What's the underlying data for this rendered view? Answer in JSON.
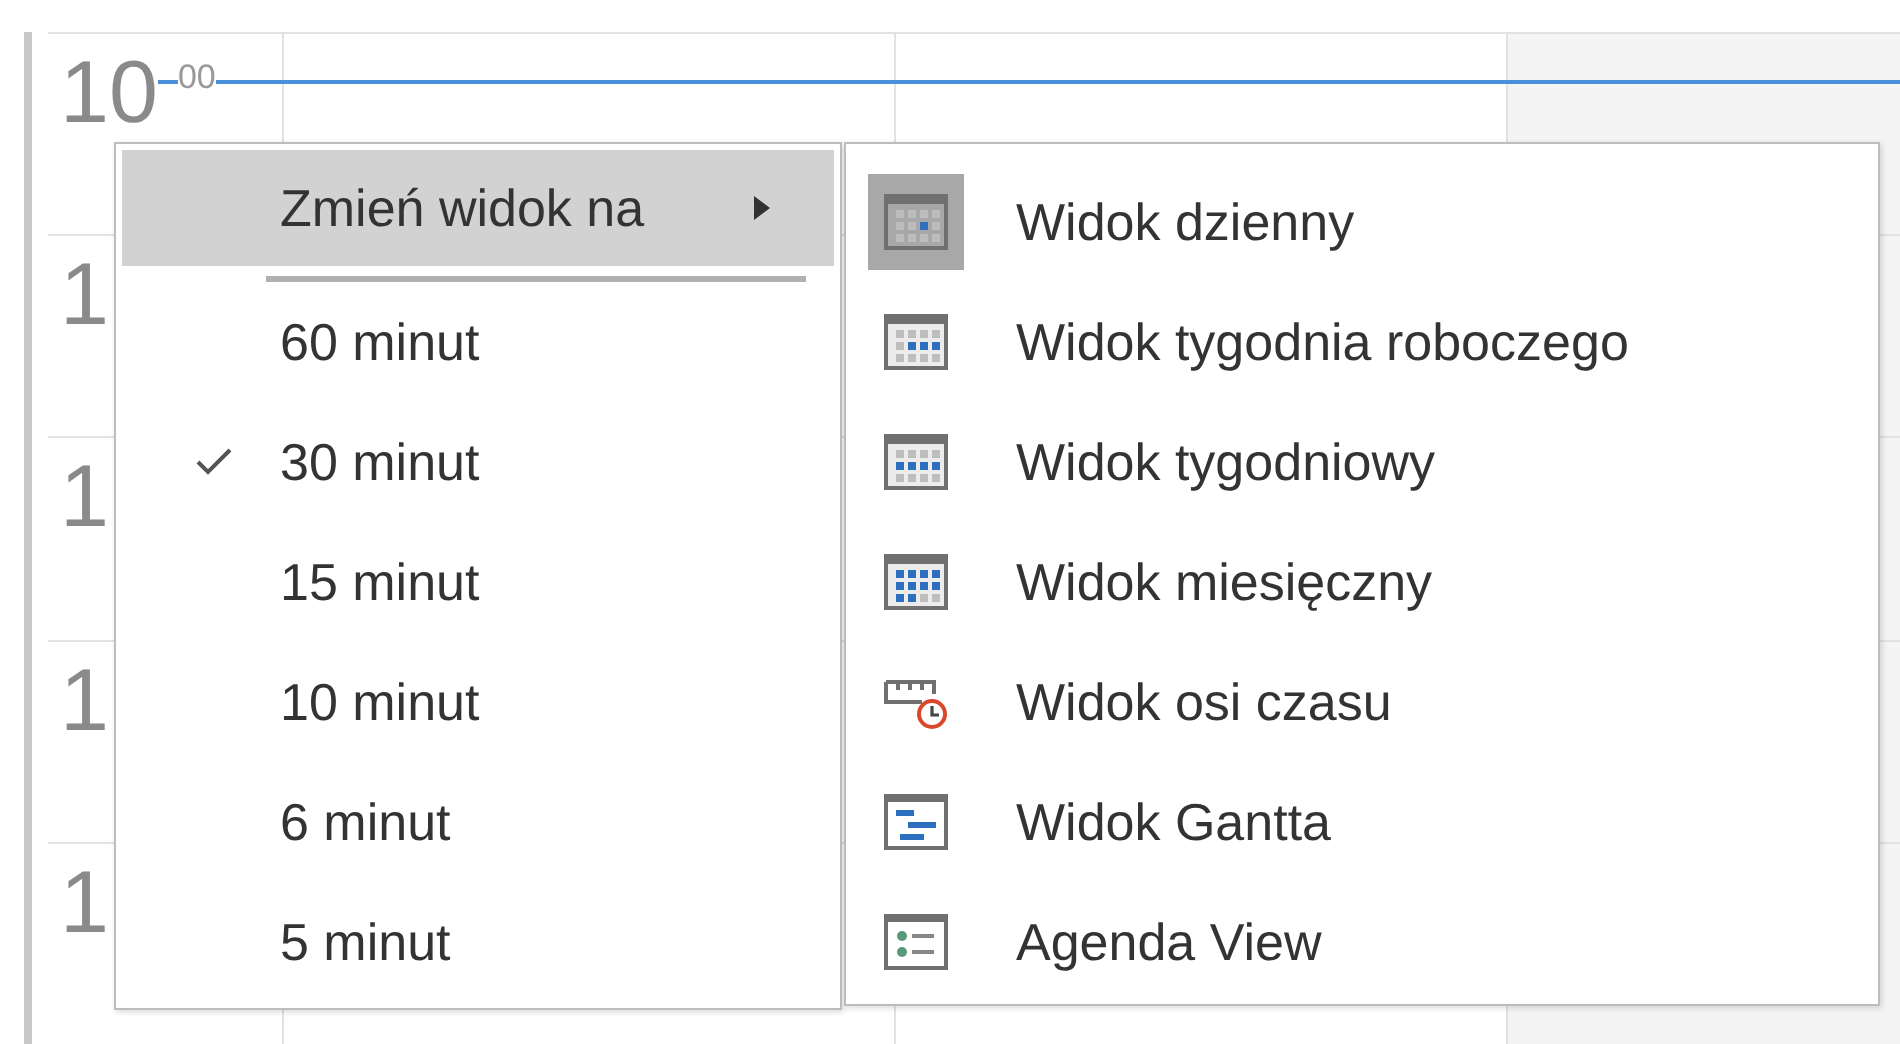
{
  "calendar": {
    "hours": [
      {
        "hour": "10",
        "minutes": "00"
      },
      {
        "hour": "1"
      },
      {
        "hour": "1"
      },
      {
        "hour": "1"
      },
      {
        "hour": "1"
      }
    ]
  },
  "menu": {
    "submenu_item": {
      "label": "Zmień widok na",
      "selected": true
    },
    "items": [
      {
        "label": "60 minut",
        "checked": false
      },
      {
        "label": "30 minut",
        "checked": true
      },
      {
        "label": "15 minut",
        "checked": false
      },
      {
        "label": "10 minut",
        "checked": false
      },
      {
        "label": "6 minut",
        "checked": false
      },
      {
        "label": "5 minut",
        "checked": false
      }
    ]
  },
  "submenu": {
    "items": [
      {
        "label": "Widok dzienny",
        "kind": "day",
        "selected": true
      },
      {
        "label": "Widok tygodnia roboczego",
        "kind": "workweek",
        "selected": false
      },
      {
        "label": "Widok tygodniowy",
        "kind": "week",
        "selected": false
      },
      {
        "label": "Widok miesięczny",
        "kind": "month",
        "selected": false
      },
      {
        "label": "Widok osi czasu",
        "kind": "timeline",
        "selected": false
      },
      {
        "label": "Widok Gantta",
        "kind": "gantt",
        "selected": false
      },
      {
        "label": "Agenda View",
        "kind": "agenda",
        "selected": false
      }
    ]
  }
}
